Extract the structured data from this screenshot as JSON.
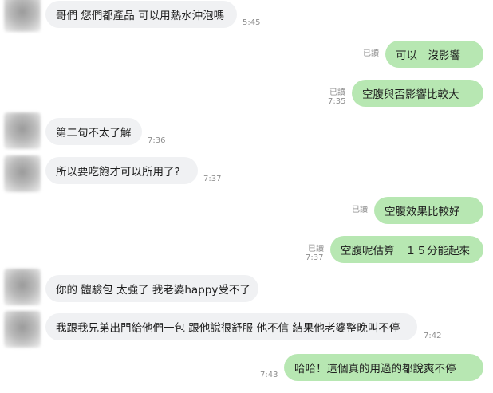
{
  "messages": [
    {
      "side": "in",
      "text": "哥們 您們都產品 可以用熱水沖泡嗎",
      "time": "5:45",
      "read": ""
    },
    {
      "side": "out",
      "text": "可以　沒影響",
      "time": "",
      "read": "已讀"
    },
    {
      "side": "out",
      "text": "空腹與否影響比較大",
      "time": "7:35",
      "read": "已讀"
    },
    {
      "side": "in",
      "text": "第二句不太了解",
      "time": "7:36",
      "read": ""
    },
    {
      "side": "in",
      "text": "所以要吃飽才可以所用了?",
      "time": "7:37",
      "read": ""
    },
    {
      "side": "out",
      "text": "空腹效果比較好",
      "time": "",
      "read": "已讀"
    },
    {
      "side": "out",
      "text": "空腹呢估算　１５分能起來",
      "time": "7:37",
      "read": "已讀"
    },
    {
      "side": "in",
      "text": "你的 體驗包 太強了 我老婆happy受不了",
      "time": "",
      "read": ""
    },
    {
      "side": "in",
      "text": "我跟我兄弟出門給他們一包 跟他說很舒服 他不信 結果他老婆整晚叫不停",
      "time": "7:42",
      "read": ""
    },
    {
      "side": "out",
      "text": "哈哈！這個真的用過的都說爽不停",
      "time": "7:43",
      "read": ""
    }
  ]
}
